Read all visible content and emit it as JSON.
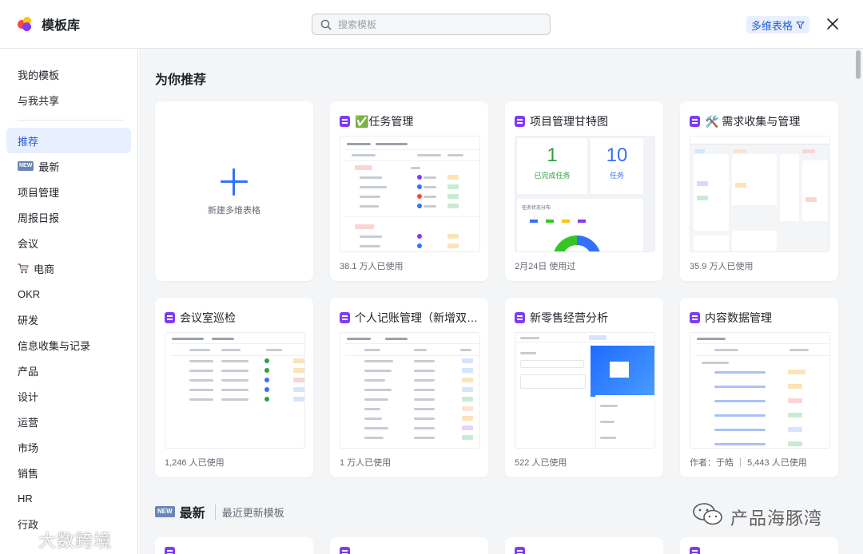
{
  "app": {
    "title": "模板库"
  },
  "search": {
    "placeholder": "搜索模板"
  },
  "filter": {
    "label": "多维表格"
  },
  "sidebar": {
    "top_items": [
      {
        "label": "我的模板"
      },
      {
        "label": "与我共享"
      }
    ],
    "items": [
      {
        "label": "推荐",
        "active": true
      },
      {
        "label": "最新",
        "badge": "NEW"
      },
      {
        "label": "项目管理"
      },
      {
        "label": "周报日报"
      },
      {
        "label": "会议"
      },
      {
        "label": "电商",
        "icon": "cart-icon"
      },
      {
        "label": "OKR"
      },
      {
        "label": "研发"
      },
      {
        "label": "信息收集与记录"
      },
      {
        "label": "产品"
      },
      {
        "label": "设计"
      },
      {
        "label": "运营"
      },
      {
        "label": "市场"
      },
      {
        "label": "销售"
      },
      {
        "label": "HR"
      },
      {
        "label": "行政"
      }
    ]
  },
  "main": {
    "section_title": "为你推荐",
    "new_card_label": "新建多维表格",
    "cards": [
      {
        "title": "✅任务管理",
        "usage": "38.1 万人已使用"
      },
      {
        "title": "项目管理甘特图",
        "usage": "2月24日 使用过",
        "preview": {
          "stat1_value": "1",
          "stat1_label": "已完成任务",
          "stat2_value": "10",
          "stat2_label": "任务",
          "chart_title": "任务状态分布"
        }
      },
      {
        "title": "🛠️ 需求收集与管理",
        "usage": "35.9 万人已使用"
      },
      {
        "title": "会议室巡检",
        "usage": "1,246 人已使用"
      },
      {
        "title": "个人记账管理（新增双向…",
        "usage": "1 万人已使用"
      },
      {
        "title": "新零售经营分析",
        "usage": "522 人已使用"
      },
      {
        "title": "内容数据管理",
        "usage": "作者：于皓 ｜ 5,443 人已使用"
      }
    ],
    "section2_badge": "NEW",
    "section2_title": "最新",
    "section2_subtitle": "最近更新模板"
  },
  "watermarks": {
    "left": "大数跨境",
    "right": "产品海豚湾"
  },
  "colors": {
    "accent": "#3370ff",
    "bitable_icon": "#7f3bf5",
    "active_bg": "#e8f0ff"
  }
}
